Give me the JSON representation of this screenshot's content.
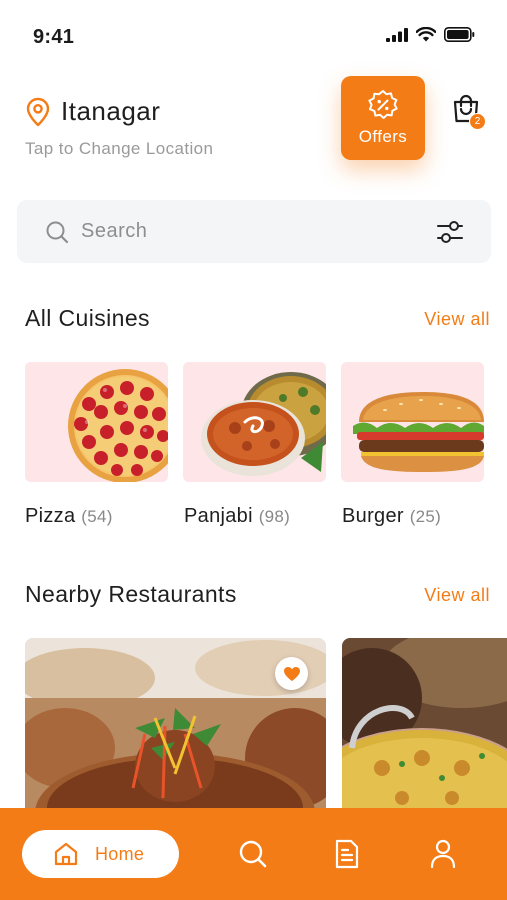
{
  "status_bar": {
    "time": "9:41"
  },
  "location": {
    "city": "Itanagar",
    "subtitle": "Tap to Change Location"
  },
  "offers": {
    "label": "Offers"
  },
  "cart": {
    "badge_count": "2"
  },
  "search": {
    "placeholder": "Search"
  },
  "cuisines": {
    "title": "All Cuisines",
    "view_all": "View all",
    "items": [
      {
        "name": "Pizza",
        "count": "(54)"
      },
      {
        "name": "Panjabi",
        "count": "(98)"
      },
      {
        "name": "Burger",
        "count": "(25)"
      }
    ]
  },
  "restaurants": {
    "title": "Nearby Restaurants",
    "view_all": "View all"
  },
  "bottom_nav": {
    "home_label": "Home"
  },
  "colors": {
    "accent": "#f47c17",
    "card_pink": "#fde5e8",
    "search_bg": "#f4f5f7"
  },
  "icons": [
    "location-pin-icon",
    "offer-badge-icon",
    "cart-icon",
    "search-icon",
    "filter-icon",
    "heart-icon",
    "home-icon",
    "search-nav-icon",
    "orders-icon",
    "profile-icon"
  ]
}
